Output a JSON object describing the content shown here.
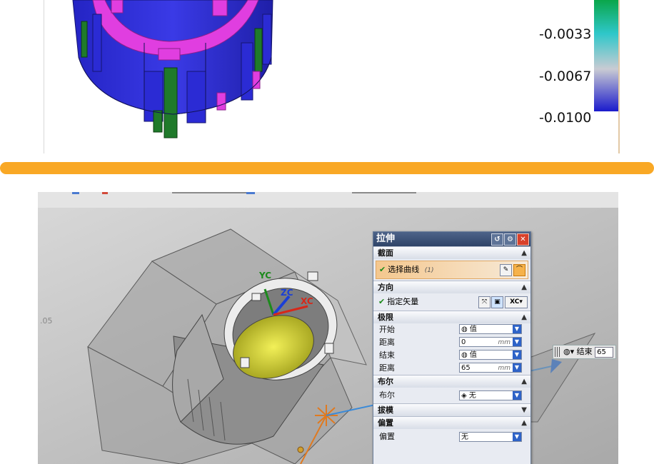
{
  "top_panel": {
    "legend_values": [
      "-0.0033",
      "-0.0067",
      "-0.0100"
    ],
    "colors": {
      "gradient_top": "#0aa64a",
      "gradient_mid": "#2ec7c9",
      "gradient_light": "#c9cbd3",
      "gradient_bottom": "#1a1acc",
      "part_blue": "#2b2bd4",
      "part_magenta": "#e03ee0",
      "part_green": "#1f7a2a"
    }
  },
  "divider": {
    "color": "#f9a825"
  },
  "viewport": {
    "coord_label": ".05",
    "axis_labels": {
      "yc": "YC",
      "zc": "ZC",
      "xc": "XC"
    }
  },
  "dialog": {
    "title": "拉伸",
    "title_buttons": [
      "↺",
      "⚙",
      "✕"
    ],
    "sections": {
      "section": "截面",
      "direction": "方向",
      "limits": "极限",
      "boolean": "布尔",
      "draft": "拔模",
      "offset": "偏置"
    },
    "select_curve": {
      "label": "选择曲线",
      "count": "(1)"
    },
    "specify_vector": {
      "label": "指定矢量",
      "xc_button": "XC"
    },
    "limits": {
      "start_label": "开始",
      "start_value": "值",
      "start_distance_label": "距离",
      "start_distance": "0",
      "end_label": "结束",
      "end_value": "值",
      "end_distance_label": "距离",
      "end_distance": "65",
      "unit": "mm"
    },
    "boolean": {
      "label": "布尔",
      "value": "无"
    },
    "offset": {
      "label": "偏置",
      "value": "无"
    }
  },
  "end_widget": {
    "label": "结束",
    "value": "65"
  }
}
